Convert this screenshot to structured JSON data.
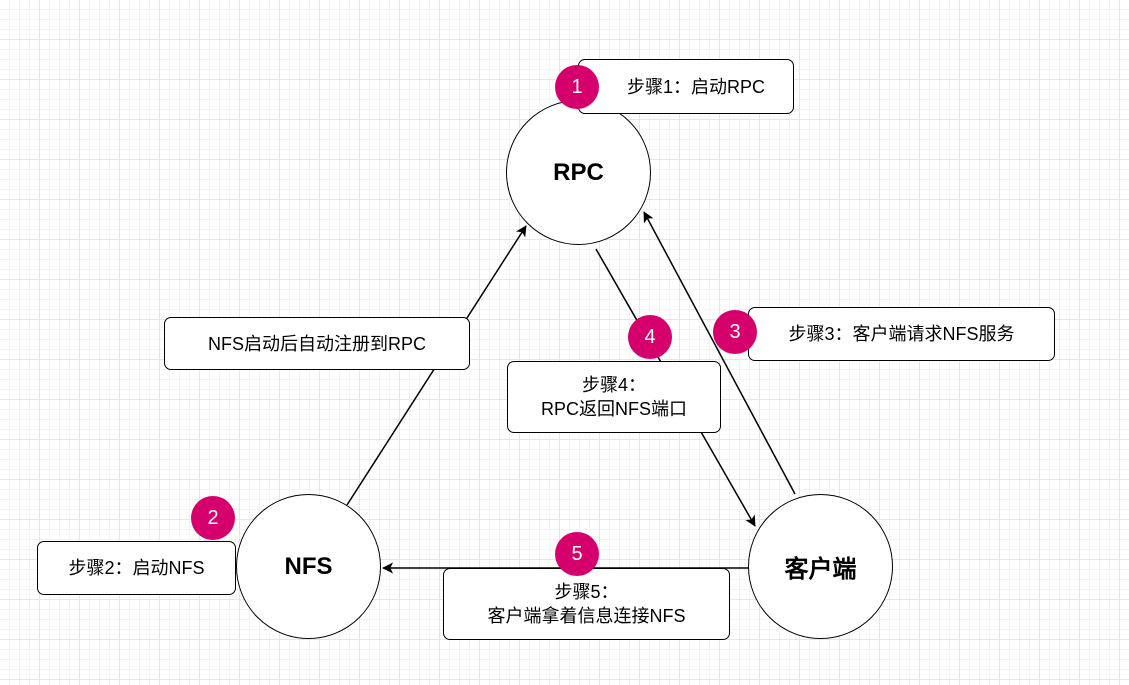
{
  "nodes": {
    "rpc": "RPC",
    "nfs": "NFS",
    "client": "客户端"
  },
  "steps": {
    "step1": {
      "number": "1",
      "text": "步骤1：启动RPC"
    },
    "step2": {
      "number": "2",
      "text": "步骤2：启动NFS"
    },
    "step3": {
      "number": "3",
      "text": "步骤3：客户端请求NFS服务"
    },
    "step4": {
      "number": "4",
      "line1": "步骤4：",
      "line2": "RPC返回NFS端口"
    },
    "step5": {
      "number": "5",
      "line1": "步骤5：",
      "line2": "客户端拿着信息连接NFS"
    }
  },
  "edge_labels": {
    "nfs_to_rpc": "NFS启动后自动注册到RPC"
  },
  "colors": {
    "badge": "#d6006d",
    "stroke": "#000000",
    "grid": "#e6e6e6"
  }
}
